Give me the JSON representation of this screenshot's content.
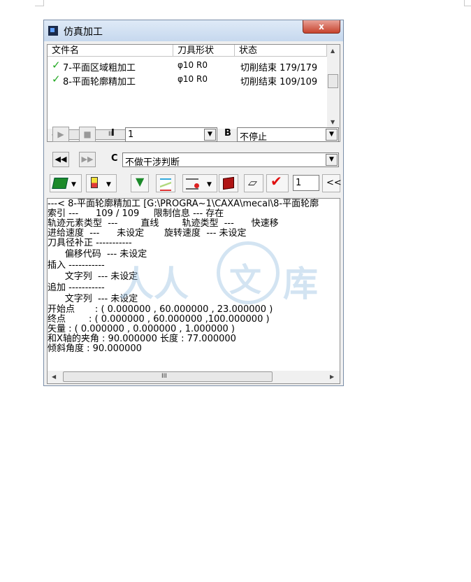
{
  "window": {
    "title": "仿真加工",
    "close_label": "x"
  },
  "file_list": {
    "columns": [
      "文件名",
      "刀具形状",
      "状态"
    ],
    "rows": [
      {
        "check": "✓",
        "name": "7-平面区域粗加工",
        "tool": "φ10 R0",
        "status": "切削结束 179/179"
      },
      {
        "check": "✓",
        "name": "8-平面轮廓精加工",
        "tool": "φ10 R0",
        "status": "切削结束 109/109"
      }
    ],
    "hscroll_grip": "III"
  },
  "controls": {
    "play_icon": "▶",
    "stop_icon": "■",
    "rewind_icon": "◀◀",
    "forward_icon": "▶▶",
    "I_label": "I",
    "I_value": "1",
    "B_label": "B",
    "B_value": "不停止",
    "C_label": "C",
    "C_value": "不做干涉判断",
    "dropdown_arrow": "▼"
  },
  "toolbar": {
    "step_value": "1",
    "collapse_label": "<<"
  },
  "info": {
    "lines": [
      "---< 8-平面轮廓精加工 [G:\\PROGRA~1\\CAXA\\mecal\\8-平面轮廓",
      "索引 ---      109 / 109     限制信息 --- 存在",
      "轨迹元素类型  ---        直线        轨迹类型  ---      快速移",
      "进给速度  ---      未设定       旋转速度  --- 未设定",
      "刀具径补正 -----------",
      "      偏移代码  --- 未设定",
      "插入 -----------",
      "      文字列  --- 未设定",
      "追加 -----------",
      "      文字列  --- 未设定",
      "开始点       : ( 0.000000 , 60.000000 , 23.000000 )",
      "终点        : ( 0.000000 , 60.000000 ,100.000000 )",
      "矢量 : ( 0.000000 , 0.000000 , 1.000000 )",
      "和X轴的夹角 : 90.000000 长度 : 77.000000",
      "倾斜角度 : 90.000000"
    ],
    "hscroll_grip": "III"
  },
  "watermark": {
    "text1": "人人",
    "text2": "文",
    "text3": "库"
  },
  "colors": {
    "check": "#22a822",
    "close_button": "#c7432d",
    "titlebar": "#c6d8ee"
  }
}
